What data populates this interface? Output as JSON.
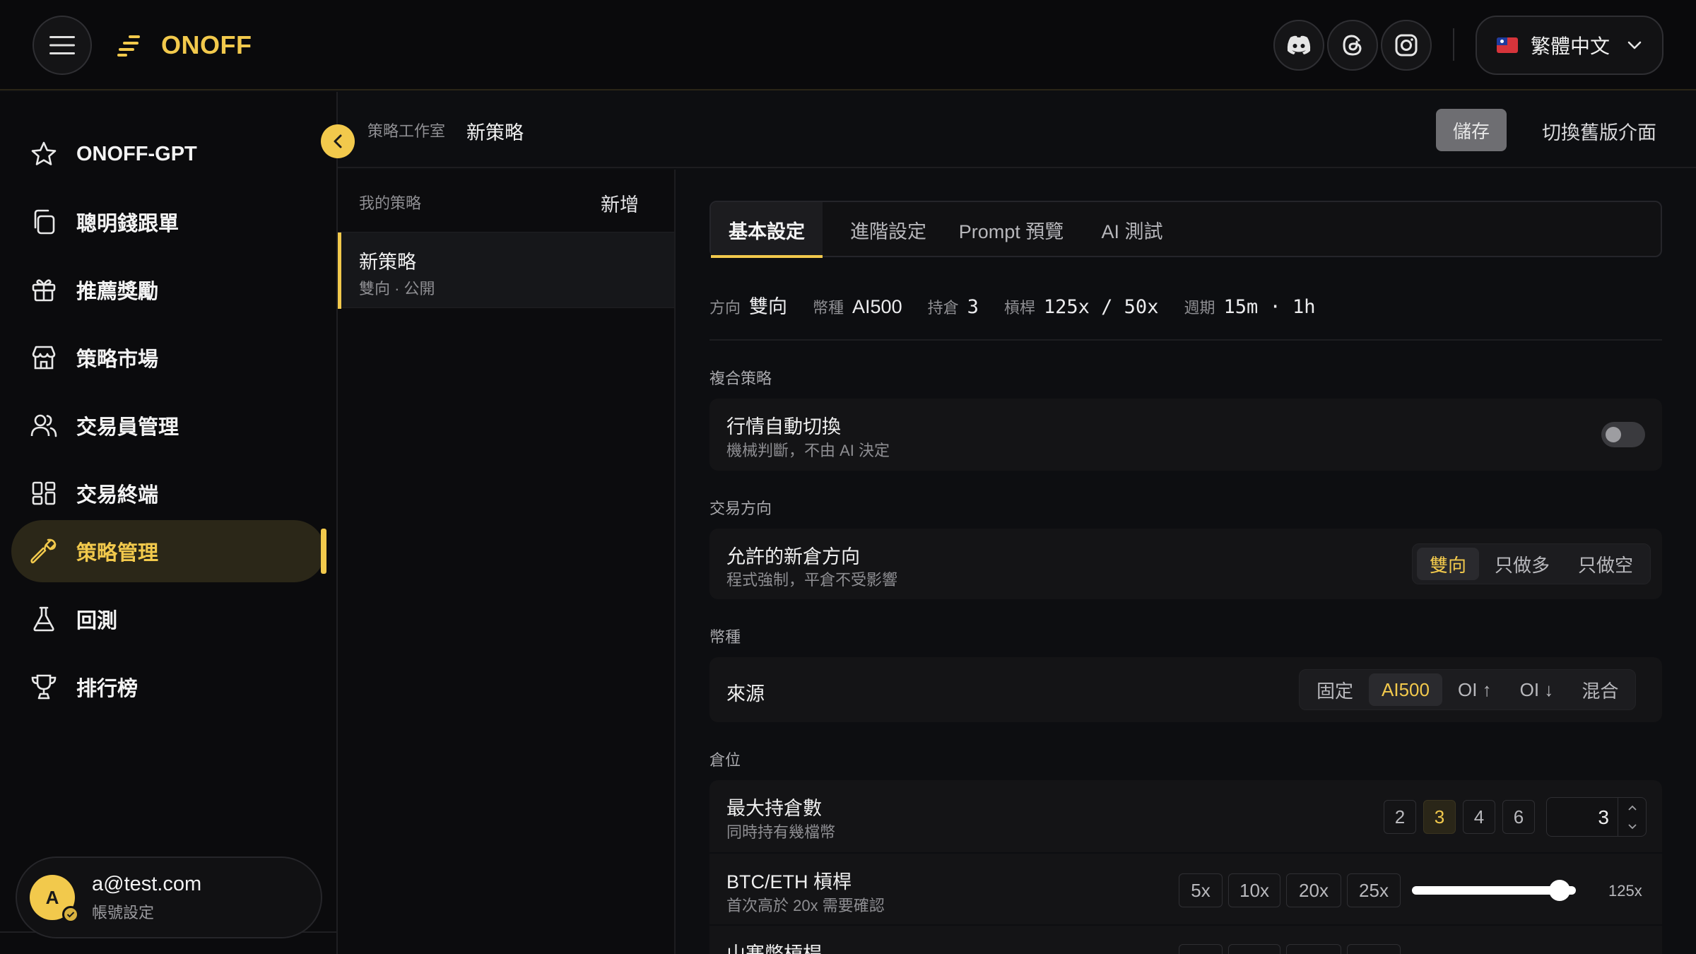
{
  "header": {
    "brand": "ONOFF",
    "social_icons": [
      "discord-icon",
      "threads-icon",
      "instagram-icon"
    ],
    "language": "繁體中文"
  },
  "sidebar": {
    "items": [
      {
        "label": "ONOFF-GPT",
        "icon": "star-icon"
      },
      {
        "label": "聰明錢跟單",
        "icon": "copy-icon"
      },
      {
        "label": "推薦獎勵",
        "icon": "gift-icon"
      },
      {
        "label": "策略市場",
        "icon": "store-icon"
      },
      {
        "label": "交易員管理",
        "icon": "users-icon"
      },
      {
        "label": "交易終端",
        "icon": "grid-icon"
      },
      {
        "label": "策略管理",
        "icon": "wrench-icon",
        "active": true
      },
      {
        "label": "回測",
        "icon": "flask-icon"
      },
      {
        "label": "排行榜",
        "icon": "trophy-icon"
      }
    ],
    "user": {
      "avatar_letter": "A",
      "email": "a@test.com",
      "sub": "帳號設定"
    }
  },
  "breadcrumb": {
    "root": "策略工作室",
    "current": "新策略"
  },
  "actions": {
    "save": "儲存",
    "legacy": "切換舊版介面"
  },
  "strategy_list": {
    "header": "我的策略",
    "add": "新增",
    "items": [
      {
        "title": "新策略",
        "sub": "雙向 · 公開"
      }
    ]
  },
  "tabs": [
    "基本設定",
    "進階設定",
    "Prompt 預覽",
    "AI 測試"
  ],
  "summary": [
    {
      "k": "方向",
      "v": "雙向"
    },
    {
      "k": "幣種",
      "v": "AI500"
    },
    {
      "k": "持倉",
      "v": "3"
    },
    {
      "k": "槓桿",
      "v": "125x / 50x"
    },
    {
      "k": "週期",
      "v": "15m · 1h"
    }
  ],
  "sections": {
    "composite": {
      "title": "複合策略",
      "auto_switch": {
        "title": "行情自動切換",
        "sub": "機械判斷，不由 AI 決定",
        "enabled": false
      }
    },
    "direction": {
      "title": "交易方向",
      "allowed": {
        "title": "允許的新倉方向",
        "sub": "程式強制，平倉不受影響",
        "options": [
          "雙向",
          "只做多",
          "只做空"
        ],
        "selected": "雙向"
      }
    },
    "coins": {
      "title": "幣種",
      "source": {
        "title": "來源",
        "options": [
          "固定",
          "AI500",
          "OI ↑",
          "OI ↓",
          "混合"
        ],
        "selected": "AI500"
      }
    },
    "position": {
      "title": "倉位",
      "max_positions": {
        "title": "最大持倉數",
        "sub": "同時持有幾檔幣",
        "presets": [
          "2",
          "3",
          "4",
          "6"
        ],
        "selected": "3",
        "value": "3"
      },
      "btc_eth_leverage": {
        "title": "BTC/ETH 槓桿",
        "sub": "首次高於 20x 需要確認",
        "presets": [
          "5x",
          "10x",
          "20x",
          "25x"
        ],
        "slider_fraction": 0.9,
        "value": "125x"
      },
      "alt_leverage": {
        "title": "山寨幣槓桿"
      }
    }
  }
}
